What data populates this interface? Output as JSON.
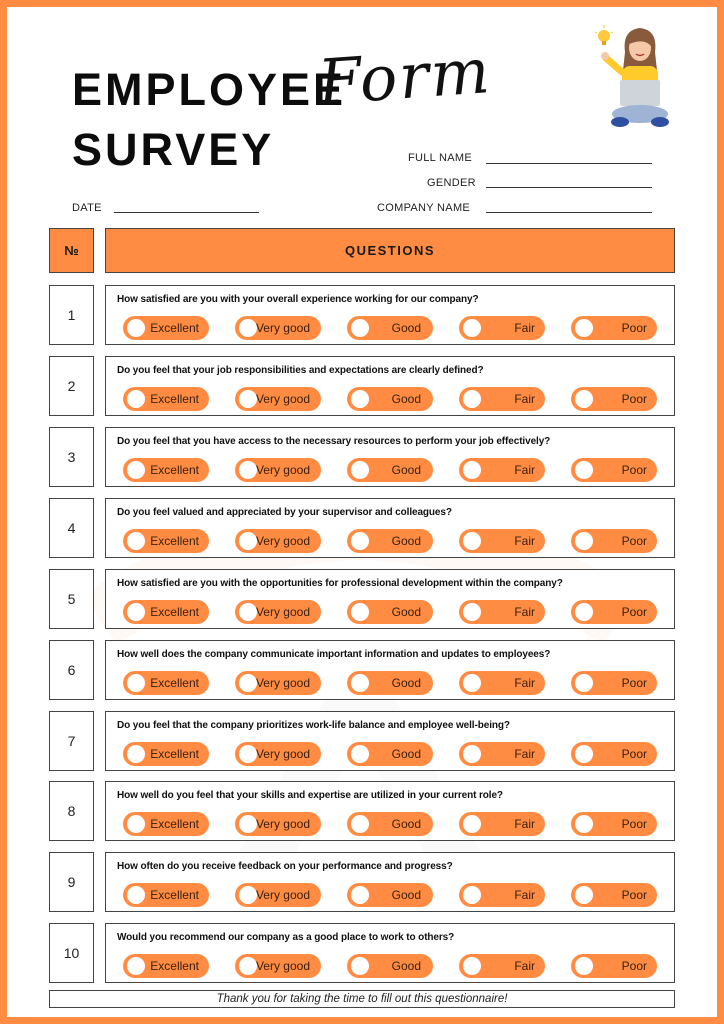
{
  "header": {
    "title_line1": "EMPLOYEE",
    "title_line2": "SURVEY",
    "title_script": "Form",
    "illustration": "woman-with-laptop-illustration"
  },
  "fields": {
    "full_name": {
      "label": "FULL NAME",
      "value": ""
    },
    "gender": {
      "label": "GENDER",
      "value": ""
    },
    "company_name": {
      "label": "COMPANY NAME",
      "value": ""
    },
    "date": {
      "label": "DATE",
      "value": ""
    }
  },
  "table": {
    "col_number": "№",
    "col_questions": "QUESTIONS",
    "options": [
      "Excellent",
      "Very good",
      "Good",
      "Fair",
      "Poor"
    ],
    "questions": [
      {
        "number": "1",
        "text": "How satisfied are you with your overall experience working for our company?"
      },
      {
        "number": "2",
        "text": "Do you feel that your job responsibilities and expectations are clearly defined?"
      },
      {
        "number": "3",
        "text": "Do you feel that you have access to the necessary resources to perform your job effectively?"
      },
      {
        "number": "4",
        "text": "Do you feel valued and appreciated by your supervisor and colleagues?"
      },
      {
        "number": "5",
        "text": "How satisfied are you with the opportunities for professional development within the company?"
      },
      {
        "number": "6",
        "text": "How well does the company communicate important information and updates to employees?"
      },
      {
        "number": "7",
        "text": "Do you feel that the company prioritizes work-life balance and employee well-being?"
      },
      {
        "number": "8",
        "text": "How well do you feel that your skills and expertise are utilized in your current role?"
      },
      {
        "number": "9",
        "text": "How often do you receive feedback on your performance and progress?"
      },
      {
        "number": "10",
        "text": "Would you recommend our company as a good place to work to others?"
      }
    ]
  },
  "footer": {
    "thanks": "Thank you for taking the time to fill out this questionnaire!"
  },
  "colors": {
    "accent": "#FF8C42",
    "text": "#111111",
    "border": "#444444"
  }
}
